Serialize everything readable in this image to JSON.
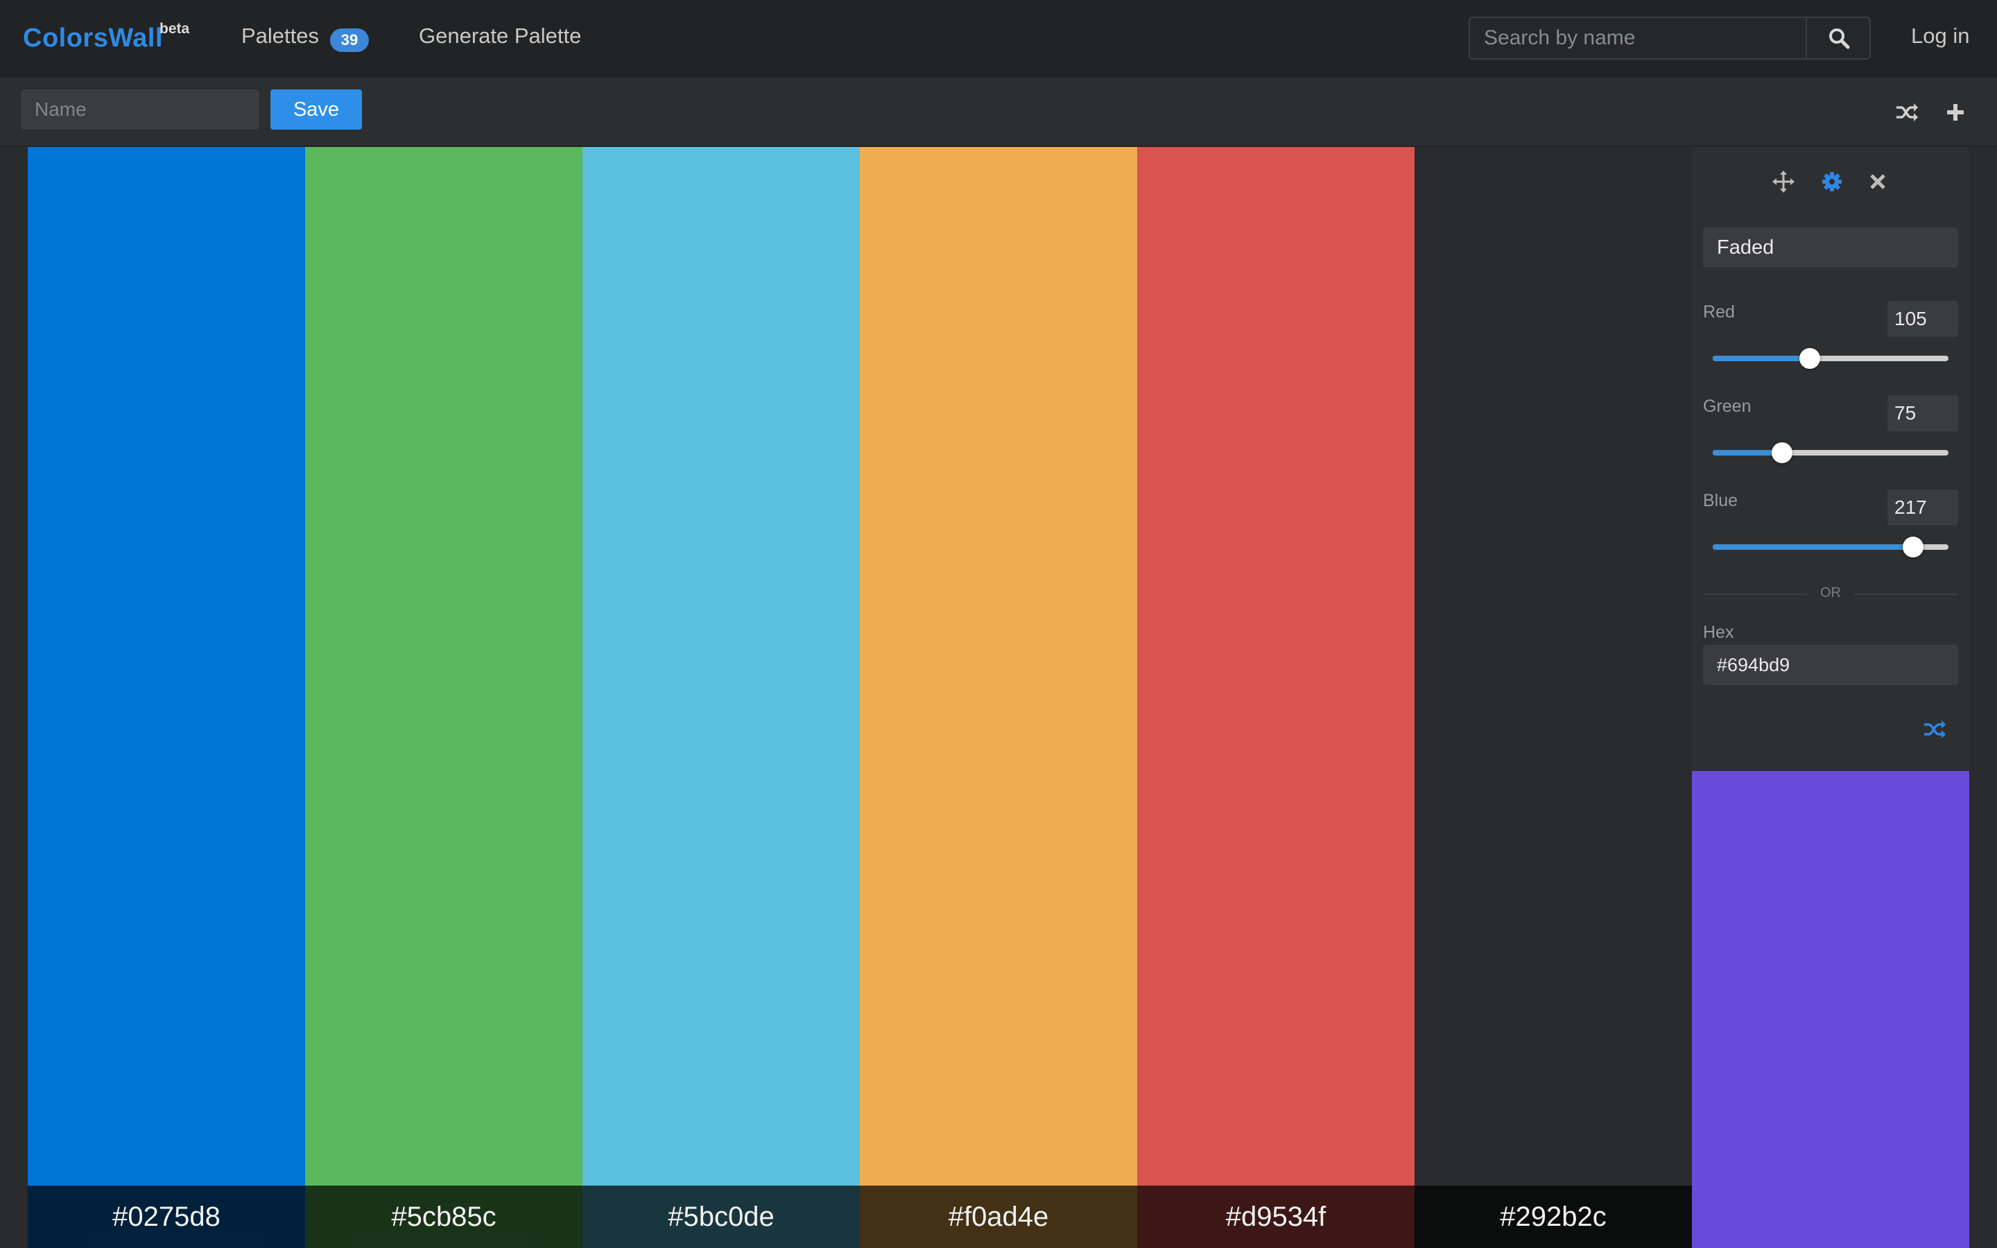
{
  "navbar": {
    "brand": "ColorsWall",
    "brand_tag": "beta",
    "palettes_label": "Palettes",
    "palettes_count": "39",
    "generate_label": "Generate Palette",
    "search_placeholder": "Search by name",
    "login_label": "Log in"
  },
  "toolbar": {
    "name_placeholder": "Name",
    "save_label": "Save"
  },
  "palette": {
    "swatches": [
      {
        "hex": "#0275d8",
        "label": "#0275d8"
      },
      {
        "hex": "#5cb85c",
        "label": "#5cb85c"
      },
      {
        "hex": "#5bc0de",
        "label": "#5bc0de"
      },
      {
        "hex": "#f0ad4e",
        "label": "#f0ad4e"
      },
      {
        "hex": "#d9534f",
        "label": "#d9534f"
      },
      {
        "hex": "#292b2c",
        "label": "#292b2c"
      }
    ]
  },
  "editor": {
    "preset": "Faded",
    "red_label": "Red",
    "red_value": "105",
    "green_label": "Green",
    "green_value": "75",
    "blue_label": "Blue",
    "blue_value": "217",
    "or_label": "OR",
    "hex_label": "Hex",
    "hex_value": "#694bd9",
    "preview_color": "#6a4bd9"
  },
  "colors": {
    "accent": "#2e8fe8",
    "brand": "#2e8ae6"
  },
  "icons": {
    "search": "search-icon",
    "shuffle": "shuffle-icon",
    "add": "plus-icon",
    "move": "move-icon",
    "settings": "gear-icon",
    "close": "close-icon"
  }
}
